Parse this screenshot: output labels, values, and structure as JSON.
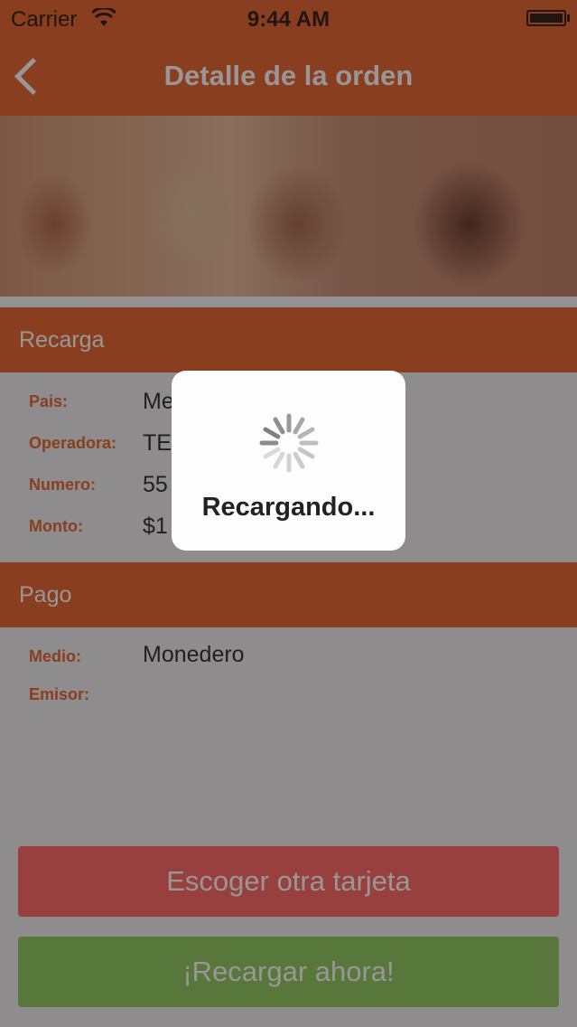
{
  "status_bar": {
    "carrier": "Carrier",
    "time": "9:44 AM"
  },
  "nav": {
    "title": "Detalle de la orden",
    "back_icon": "chevron-left-icon"
  },
  "sections": {
    "recarga": {
      "title": "Recarga",
      "rows": [
        {
          "label": "Pais:",
          "value": "Me"
        },
        {
          "label": "Operadora:",
          "value": "TE"
        },
        {
          "label": "Numero:",
          "value": "55"
        },
        {
          "label": "Monto:",
          "value": "$1"
        }
      ]
    },
    "pago": {
      "title": "Pago",
      "rows": [
        {
          "label": "Medio:",
          "value": "Monedero"
        },
        {
          "label": "Emisor:",
          "value": ""
        }
      ]
    }
  },
  "buttons": {
    "change_card": "Escoger otra tarjeta",
    "recharge_now": "¡Recargar ahora!"
  },
  "loading": {
    "message": "Recargando...",
    "icon": "spinner-icon"
  },
  "colors": {
    "brand": "#e4561e",
    "danger": "#ff5a55",
    "success": "#82c351"
  }
}
